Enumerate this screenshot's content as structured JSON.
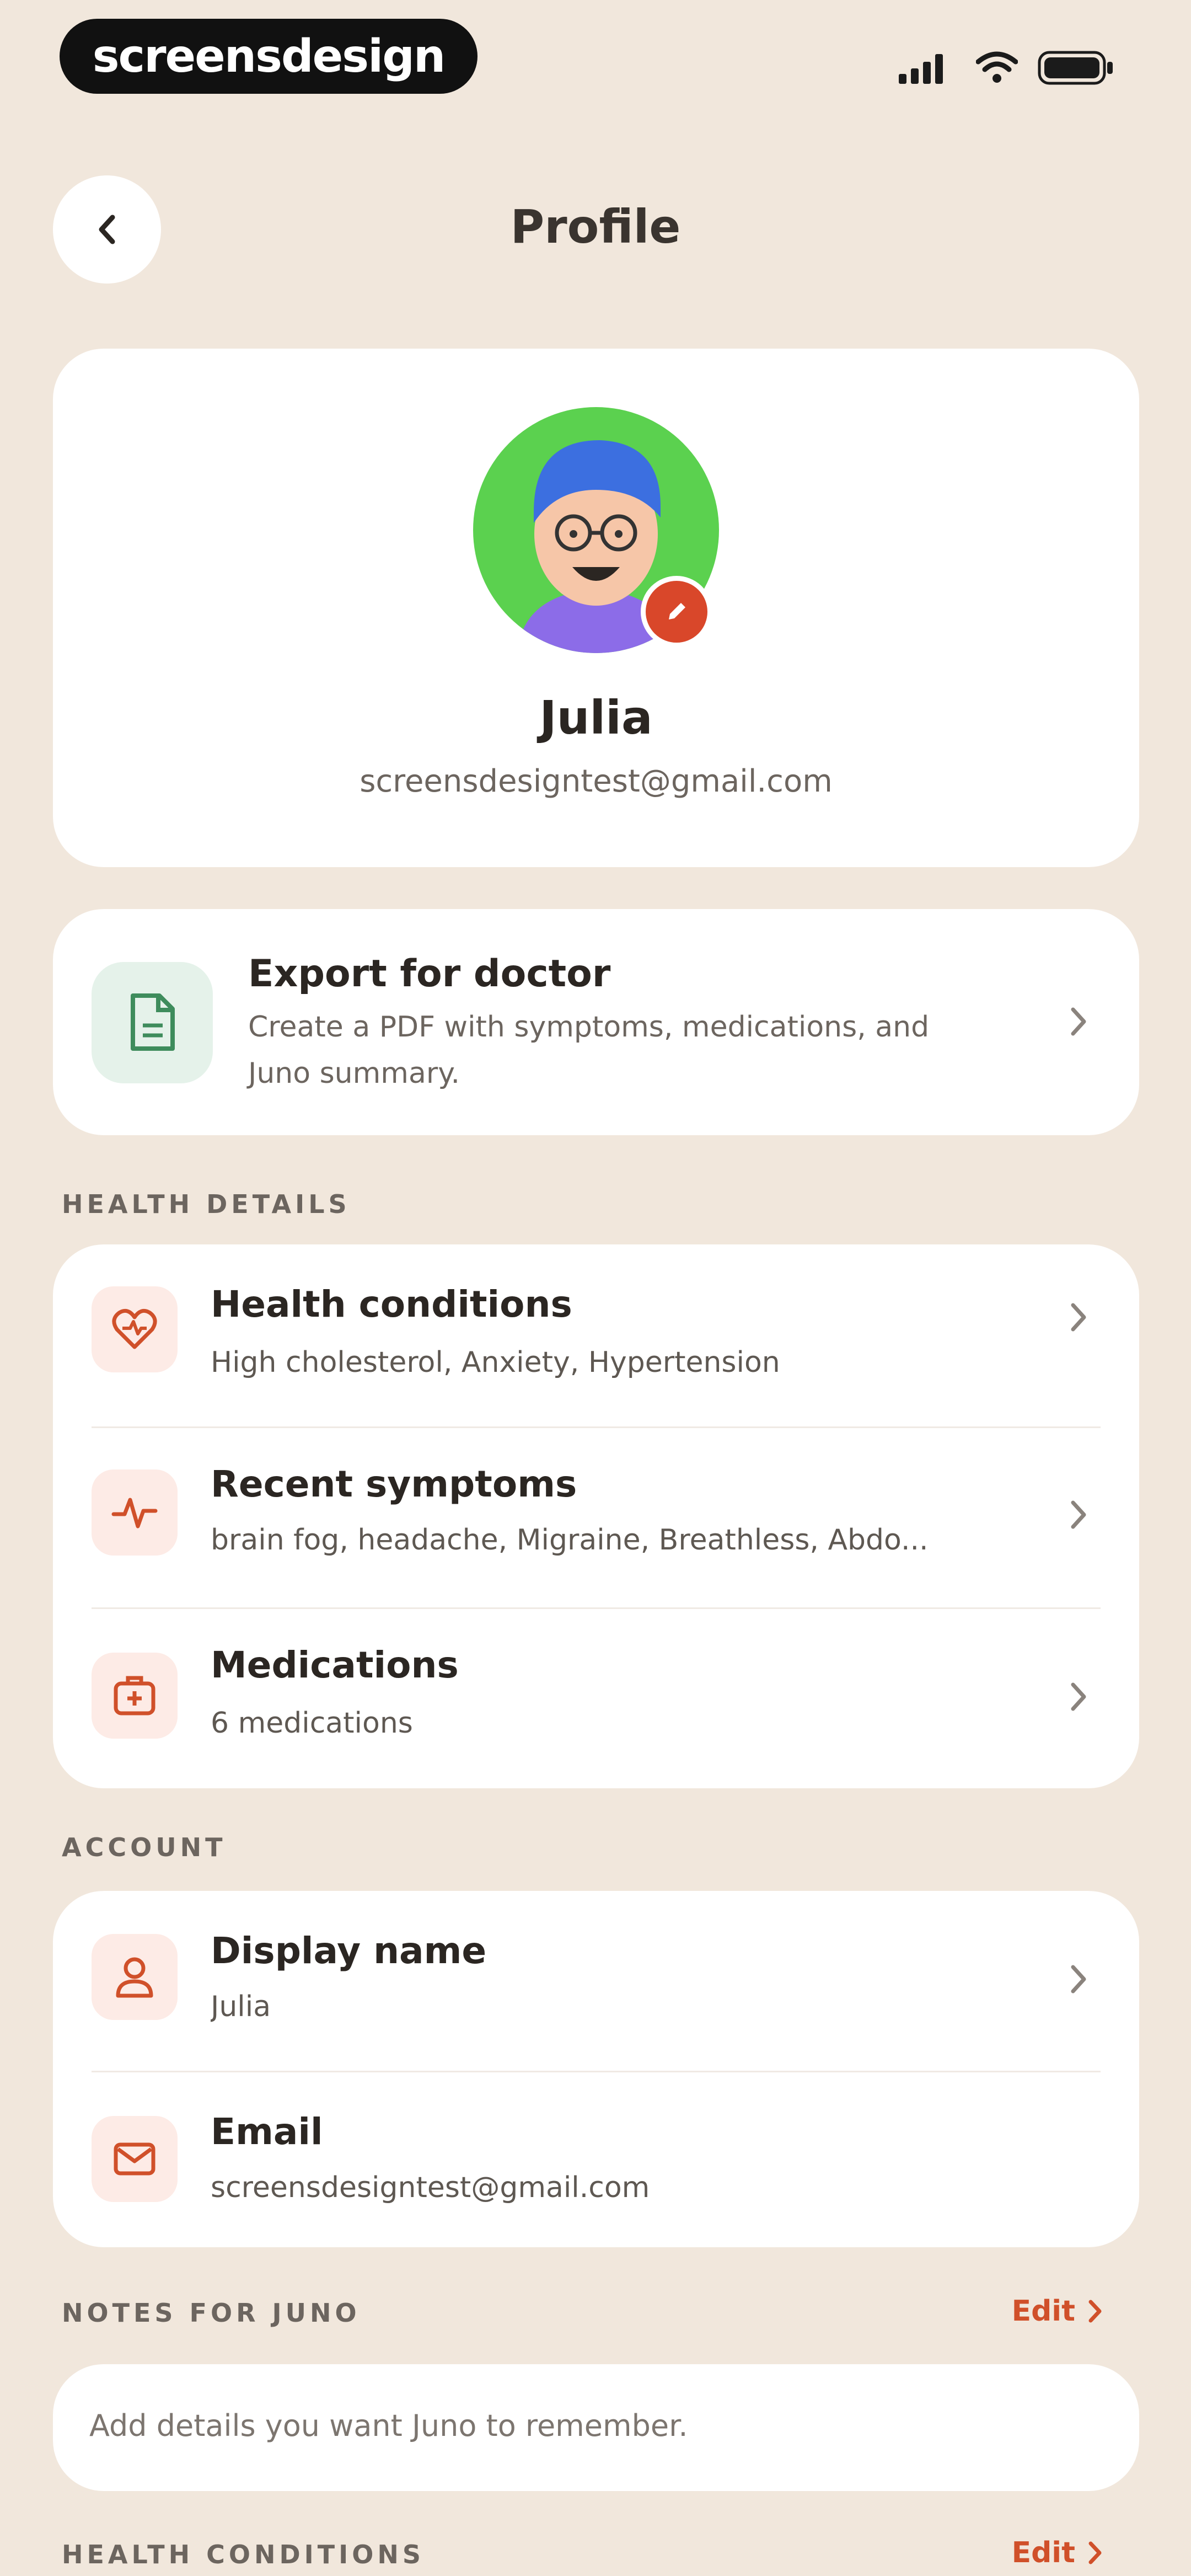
{
  "status_bar": {
    "brand": "screensdesign"
  },
  "header": {
    "title": "Profile"
  },
  "profile": {
    "name": "Julia",
    "email": "screensdesigntest@gmail.com"
  },
  "export": {
    "title": "Export for doctor",
    "subtitle_line1": "Create a PDF with symptoms, medications, and",
    "subtitle_line2": "Juno summary."
  },
  "health_details": {
    "label": "HEALTH DETAILS",
    "items": [
      {
        "title": "Health conditions",
        "subtitle": "High cholesterol, Anxiety, Hypertension",
        "icon": "heart-icon"
      },
      {
        "title": "Recent symptoms",
        "subtitle": "brain fog, headache, Migraine, Breathless, Abdo...",
        "icon": "pulse-icon"
      },
      {
        "title": "Medications",
        "subtitle": "6 medications",
        "icon": "medication-box-icon"
      }
    ]
  },
  "account": {
    "label": "ACCOUNT",
    "items": [
      {
        "title": "Display name",
        "subtitle": "Julia",
        "icon": "user-icon"
      },
      {
        "title": "Email",
        "subtitle": "screensdesigntest@gmail.com",
        "icon": "mail-icon"
      }
    ]
  },
  "notes": {
    "label": "NOTES FOR JUNO",
    "edit_label": "Edit",
    "placeholder": "Add details you want Juno to remember."
  },
  "health_conditions": {
    "label": "HEALTH CONDITIONS",
    "edit_label": "Edit"
  },
  "colors": {
    "background": "#F1E7DC",
    "accent": "#D0502A",
    "export_tile": "#E5F2EA",
    "icon_tile": "#FDEBE6"
  }
}
